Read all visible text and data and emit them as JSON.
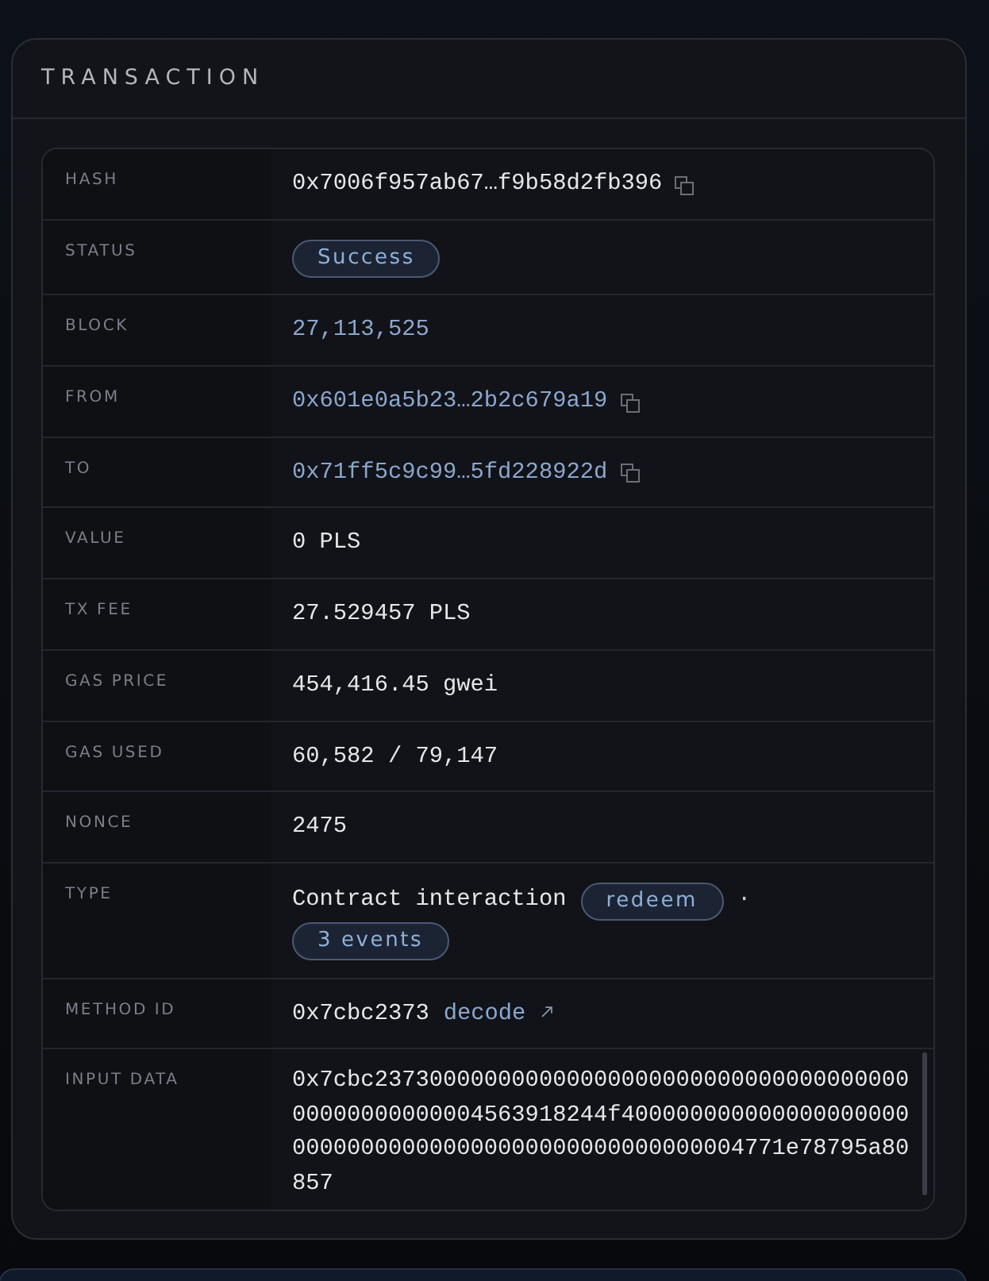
{
  "card": {
    "title": "TRANSACTION"
  },
  "rows": [
    {
      "kind": "text",
      "label": "HASH",
      "value": "0x7006f957ab67…f9b58d2fb396",
      "copy_button": true
    },
    {
      "kind": "badge",
      "label": "STATUS",
      "value": "Success",
      "copy_button": false
    },
    {
      "kind": "link",
      "label": "BLOCK",
      "value": "27,113,525",
      "copy_button": false
    },
    {
      "kind": "link",
      "label": "FROM",
      "value": "0x601e0a5b23…2b2c679a19",
      "copy_button": true
    },
    {
      "kind": "link",
      "label": "TO",
      "value": "0x71ff5c9c99…5fd228922d",
      "copy_button": true
    },
    {
      "kind": "text",
      "label": "VALUE",
      "value": "0 PLS",
      "copy_button": false
    },
    {
      "kind": "text",
      "label": "TX FEE",
      "value": "27.529457 PLS",
      "copy_button": false
    },
    {
      "kind": "text",
      "label": "GAS PRICE",
      "value": "454,416.45 gwei",
      "copy_button": false
    },
    {
      "kind": "text",
      "label": "GAS USED",
      "value": "60,582 / 79,147",
      "copy_button": false
    },
    {
      "kind": "text",
      "label": "NONCE",
      "value": "2475",
      "copy_button": false
    },
    {
      "kind": "type",
      "label": "TYPE",
      "value": "Contract interaction",
      "method_tag": "redeem",
      "separator": "·",
      "events_tag": "3 events",
      "copy_button": false
    },
    {
      "kind": "method",
      "label": "METHOD ID",
      "value": "0x7cbc2373",
      "link": "decode",
      "copy_button": false
    },
    {
      "kind": "data",
      "label": "INPUT DATA",
      "value": "0x7cbc23730000000000000000000000000000000000000000000000004563918244f400000000000000000000000000000000000000000000000000004771e78795a80857",
      "copy_button": false
    }
  ]
}
